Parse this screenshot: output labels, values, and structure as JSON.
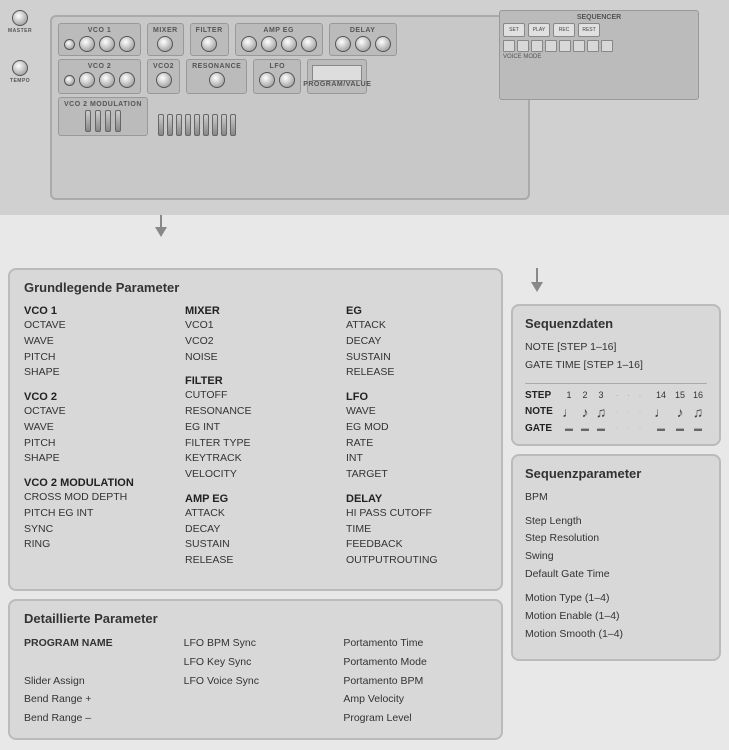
{
  "synth": {
    "sections": {
      "vco1": "VCO 1",
      "vco2": "VCO 2",
      "vco2mod": "VCO 2 MODULATION",
      "mixer": "MIXER",
      "filter": "FILTER",
      "ampEg": "AMP EG",
      "delay": "DELAY",
      "lfo": "LFO",
      "sequencer": "SEQUENCER"
    }
  },
  "grundlegende": {
    "title": "Grundlegende Parameter",
    "col1": {
      "groups": [
        {
          "title": "VCO 1",
          "items": [
            "OCTAVE",
            "WAVE",
            "PITCH",
            "SHAPE"
          ]
        },
        {
          "title": "VCO 2",
          "items": [
            "OCTAVE",
            "WAVE",
            "PITCH",
            "SHAPE"
          ]
        },
        {
          "title": "VCO 2 MODULATION",
          "items": [
            "CROSS MOD DEPTH",
            "PITCH EG INT",
            "SYNC",
            "RING"
          ]
        }
      ]
    },
    "col2": {
      "groups": [
        {
          "title": "MIXER",
          "items": [
            "VCO1",
            "VCO2",
            "NOISE"
          ]
        },
        {
          "title": "FILTER",
          "items": [
            "CUTOFF",
            "RESONANCE",
            "EG INT",
            "FILTER TYPE",
            "KEYTRACK",
            "VELOCITY"
          ]
        },
        {
          "title": "AMP EG",
          "items": [
            "ATTACK",
            "DECAY",
            "SUSTAIN",
            "RELEASE"
          ]
        }
      ]
    },
    "col3": {
      "groups": [
        {
          "title": "EG",
          "items": [
            "ATTACK",
            "DECAY",
            "SUSTAIN",
            "RELEASE"
          ]
        },
        {
          "title": "LFO",
          "items": [
            "WAVE",
            "EG MOD",
            "RATE",
            "INT",
            "TARGET"
          ]
        },
        {
          "title": "DELAY",
          "items": [
            "HI PASS CUTOFF",
            "TIME",
            "FEEDBACK",
            "OUTPUTROUTING"
          ]
        }
      ]
    }
  },
  "detaillierte": {
    "title": "Detaillierte Parameter",
    "col1": {
      "items": [
        {
          "text": "PROGRAM NAME",
          "bold": true
        },
        {
          "text": "",
          "bold": false
        },
        {
          "text": "Slider Assign",
          "bold": false
        },
        {
          "text": "Bend Range +",
          "bold": false
        },
        {
          "text": "Bend Range –",
          "bold": false
        }
      ]
    },
    "col2": {
      "items": [
        {
          "text": "LFO BPM Sync",
          "bold": false
        },
        {
          "text": "LFO Key Sync",
          "bold": false
        },
        {
          "text": "LFO Voice Sync",
          "bold": false
        },
        {
          "text": "",
          "bold": false
        },
        {
          "text": "",
          "bold": false
        }
      ]
    },
    "col3": {
      "items": [
        {
          "text": "Portamento Time",
          "bold": false
        },
        {
          "text": "Portamento Mode",
          "bold": false
        },
        {
          "text": "Portamento BPM",
          "bold": false
        },
        {
          "text": "Amp Velocity",
          "bold": false
        },
        {
          "text": "Program Level",
          "bold": false
        }
      ]
    }
  },
  "sequenzdaten": {
    "title": "Sequenzdaten",
    "info_line1": "NOTE [STEP 1–16]",
    "info_line2": "GATE TIME [STEP 1–16]",
    "step_label": "STEP",
    "note_label": "NOTE",
    "gate_label": "GATE",
    "steps_start": [
      "1",
      "2",
      "3"
    ],
    "steps_end": [
      "14",
      "15",
      "16"
    ]
  },
  "sequenzparameter": {
    "title": "Sequenzparameter",
    "group1": {
      "items": [
        "BPM"
      ]
    },
    "group2": {
      "items": [
        "Step Length",
        "Step Resolution",
        "Swing",
        "Default Gate Time"
      ]
    },
    "group3": {
      "items": [
        "Motion Type (1–4)",
        "Motion Enable (1–4)",
        "Motion Smooth (1–4)"
      ]
    }
  }
}
